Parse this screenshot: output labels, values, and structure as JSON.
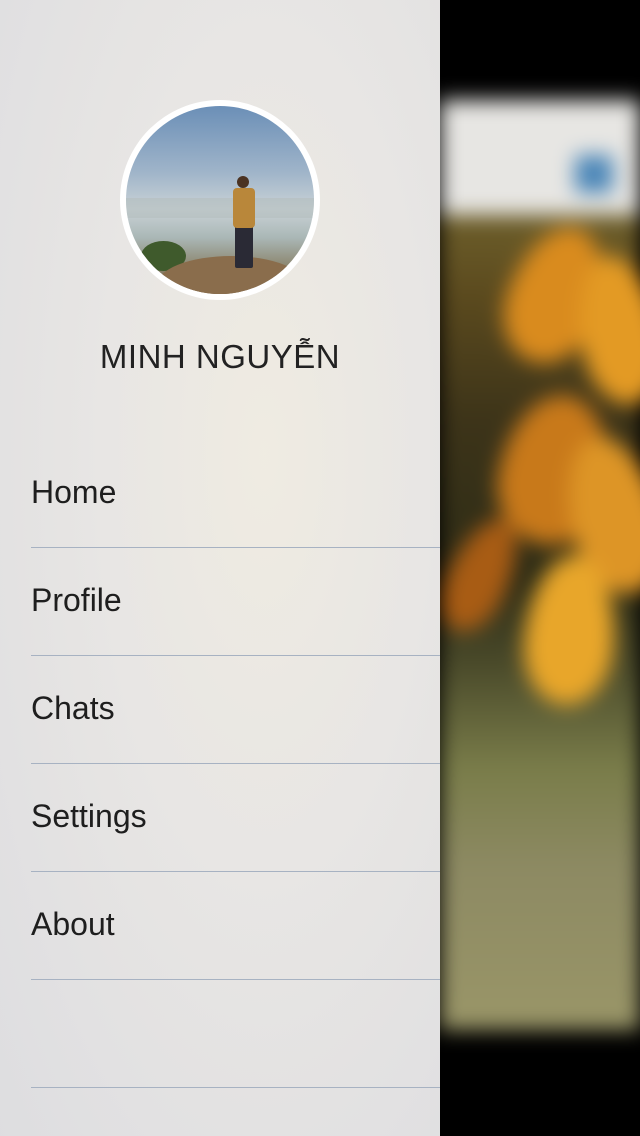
{
  "drawer": {
    "user_name": "MINH NGUYỄN",
    "avatar_icon": "user-avatar-photo",
    "menu_items": [
      {
        "label": "Home"
      },
      {
        "label": "Profile"
      },
      {
        "label": "Chats"
      },
      {
        "label": "Settings"
      },
      {
        "label": "About"
      },
      {
        "label": ""
      }
    ]
  },
  "colors": {
    "drawer_bg": "#e3e2e1",
    "divider": "#a7b2c2",
    "text": "#1e1e1e"
  }
}
